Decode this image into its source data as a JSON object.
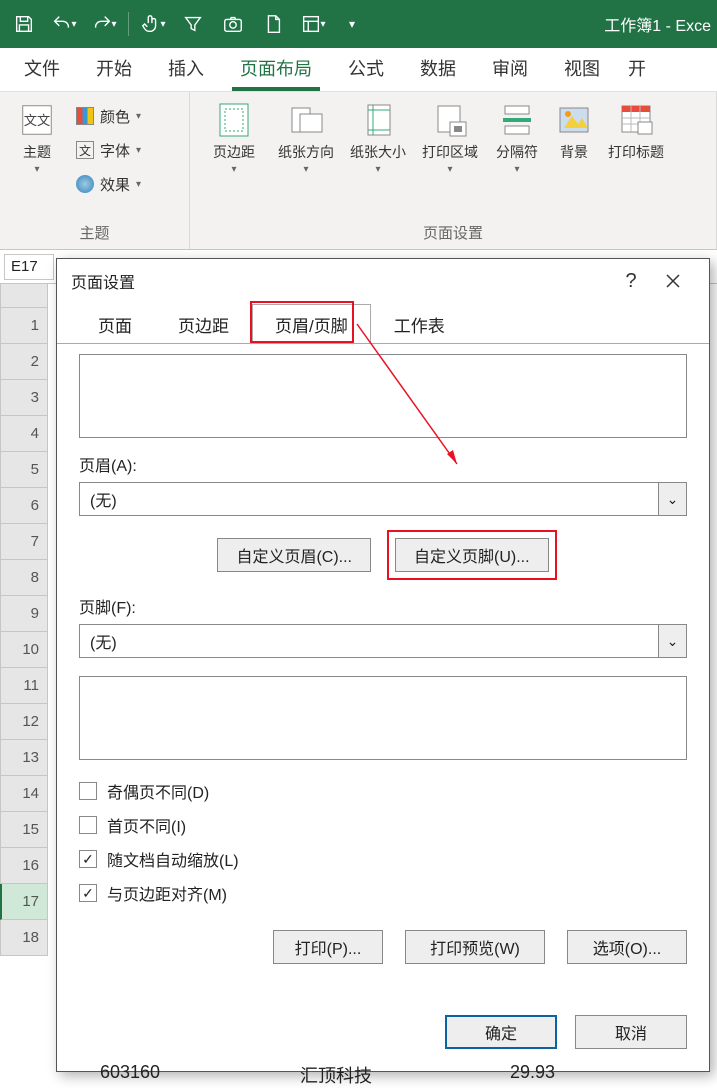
{
  "titlebar": {
    "title": "工作簿1  -  Exce"
  },
  "ribbon_tabs": [
    "文件",
    "开始",
    "插入",
    "页面布局",
    "公式",
    "数据",
    "审阅",
    "视图"
  ],
  "ribbon_tabs_extra": "开",
  "ribbon": {
    "themes": {
      "main": "主题",
      "colors": "颜色",
      "fonts": "字体",
      "effects": "效果",
      "group": "主题"
    },
    "pagesetup": {
      "margins": "页边距",
      "orientation": "纸张方向",
      "size": "纸张大小",
      "printarea": "打印区域",
      "breaks": "分隔符",
      "background": "背景",
      "titles": "打印标题",
      "group": "页面设置"
    }
  },
  "namebox": "E17",
  "rows": [
    "1",
    "2",
    "3",
    "4",
    "5",
    "6",
    "7",
    "8",
    "9",
    "10",
    "11",
    "12",
    "13",
    "14",
    "15",
    "16",
    "17",
    "18"
  ],
  "dialog": {
    "title": "页面设置",
    "tabs": [
      "页面",
      "页边距",
      "页眉/页脚",
      "工作表"
    ],
    "header_label": "页眉(A):",
    "header_value": "(无)",
    "custom_header": "自定义页眉(C)...",
    "custom_footer": "自定义页脚(U)...",
    "footer_label": "页脚(F):",
    "footer_value": "(无)",
    "chk_oddeven": "奇偶页不同(D)",
    "chk_firstpage": "首页不同(I)",
    "chk_scale": "随文档自动缩放(L)",
    "chk_align": "与页边距对齐(M)",
    "btn_print": "打印(P)...",
    "btn_preview": "打印预览(W)",
    "btn_options": "选项(O)...",
    "ok": "确定",
    "cancel": "取消"
  },
  "stray": {
    "a": "603160",
    "b": "汇顶科技",
    "c": "29.93"
  }
}
